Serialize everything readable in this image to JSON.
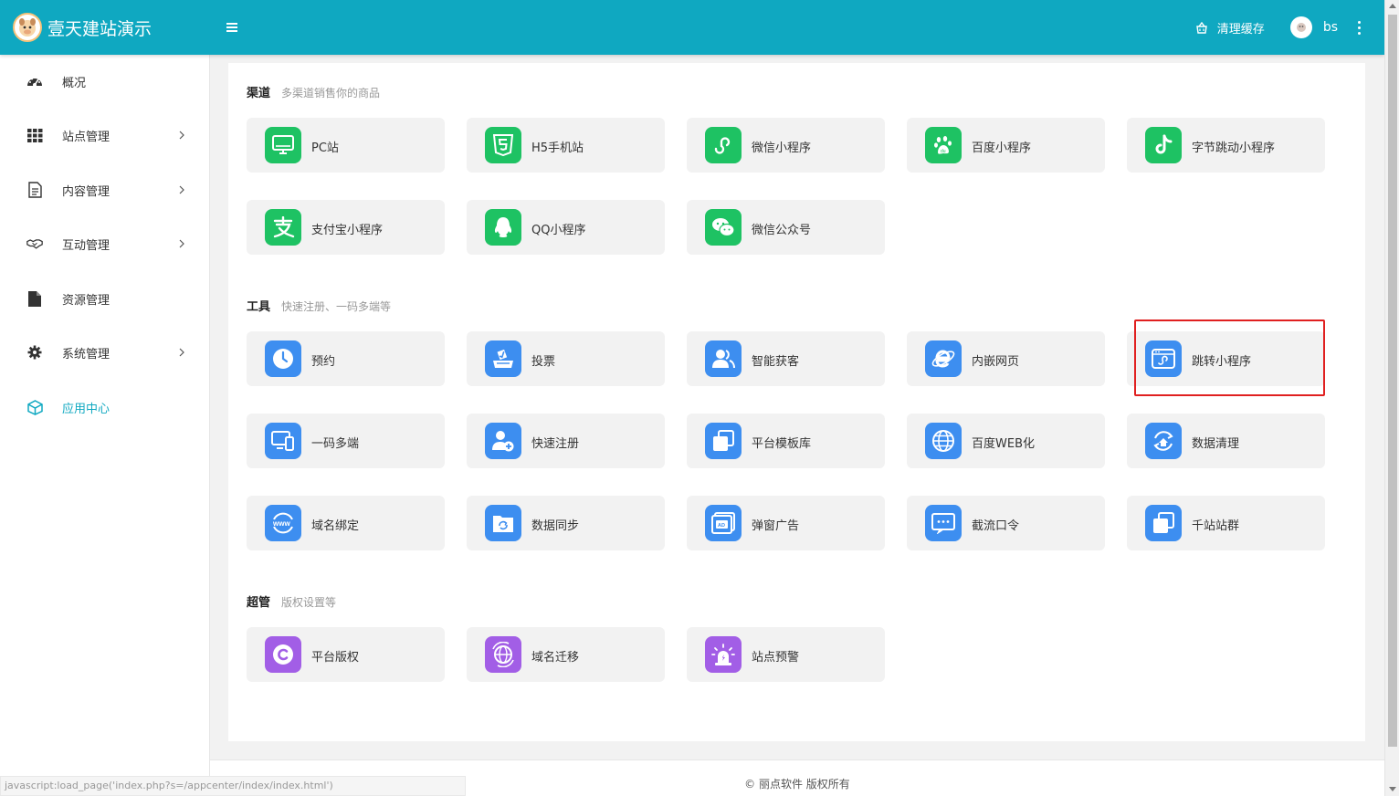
{
  "header": {
    "title": "壹天建站演示",
    "clear_cache": "清理缓存",
    "username": "bs",
    "bg_color": "#0fa8c1"
  },
  "sidebar": {
    "items": [
      {
        "label": "概况",
        "icon": "dashboard-icon",
        "arrow": false
      },
      {
        "label": "站点管理",
        "icon": "grid-icon",
        "arrow": true
      },
      {
        "label": "内容管理",
        "icon": "document-icon",
        "arrow": true
      },
      {
        "label": "互动管理",
        "icon": "handshake-icon",
        "arrow": true
      },
      {
        "label": "资源管理",
        "icon": "file-icon",
        "arrow": false
      },
      {
        "label": "系统管理",
        "icon": "gear-icon",
        "arrow": true
      },
      {
        "label": "应用中心",
        "icon": "cube-icon",
        "arrow": false,
        "active": true
      }
    ]
  },
  "sections": {
    "channel": {
      "title": "渠道",
      "subtitle": "多渠道销售你的商品",
      "items": [
        {
          "label": "PC站",
          "icon": "monitor-icon"
        },
        {
          "label": "H5手机站",
          "icon": "html5-icon"
        },
        {
          "label": "微信小程序",
          "icon": "wechat-miniprogram-icon"
        },
        {
          "label": "百度小程序",
          "icon": "baidu-paw-icon"
        },
        {
          "label": "字节跳动小程序",
          "icon": "tiktok-icon"
        },
        {
          "label": "支付宝小程序",
          "icon": "alipay-icon"
        },
        {
          "label": "QQ小程序",
          "icon": "qq-penguin-icon"
        },
        {
          "label": "微信公众号",
          "icon": "wechat-icon"
        }
      ]
    },
    "tools": {
      "title": "工具",
      "subtitle": "快速注册、一码多端等",
      "items": [
        {
          "label": "预约",
          "icon": "clock-icon"
        },
        {
          "label": "投票",
          "icon": "vote-icon"
        },
        {
          "label": "智能获客",
          "icon": "users-icon"
        },
        {
          "label": "内嵌网页",
          "icon": "ie-browser-icon"
        },
        {
          "label": "跳转小程序",
          "icon": "jump-miniprogram-icon"
        },
        {
          "label": "一码多端",
          "icon": "multi-device-icon"
        },
        {
          "label": "快速注册",
          "icon": "add-user-icon"
        },
        {
          "label": "平台模板库",
          "icon": "template-icon"
        },
        {
          "label": "百度WEB化",
          "icon": "globe-icon"
        },
        {
          "label": "数据清理",
          "icon": "data-clean-icon"
        },
        {
          "label": "域名绑定",
          "icon": "www-icon"
        },
        {
          "label": "数据同步",
          "icon": "folder-sync-icon"
        },
        {
          "label": "弹窗广告",
          "icon": "popup-ad-icon"
        },
        {
          "label": "截流口令",
          "icon": "keyword-icon"
        },
        {
          "label": "千站站群",
          "icon": "site-group-icon"
        }
      ]
    },
    "admin": {
      "title": "超管",
      "subtitle": "版权设置等",
      "items": [
        {
          "label": "平台版权",
          "icon": "copyright-icon"
        },
        {
          "label": "域名迁移",
          "icon": "domain-migrate-icon"
        },
        {
          "label": "站点预警",
          "icon": "alarm-icon"
        }
      ]
    }
  },
  "footer": {
    "copyright": "© 丽点软件 版权所有",
    "status_url": "javascript:load_page('index.php?s=/appcenter/index/index.html')"
  },
  "colors": {
    "green": "#1ec263",
    "blue": "#3d8ef0",
    "purple": "#a25ee6",
    "highlight": "#e02020"
  }
}
